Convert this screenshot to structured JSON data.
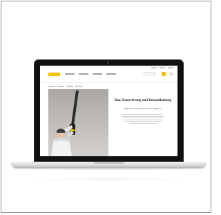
{
  "hero": {
    "title": "Bau, Renovierung und Instandhaltung",
    "subtitle": "Effiziente, flexible und sichere Angebote"
  },
  "site": {
    "logo_text": "",
    "accent_color": "#f2c200"
  },
  "icons": [
    "search-icon",
    "cart-icon",
    "account-icon"
  ]
}
